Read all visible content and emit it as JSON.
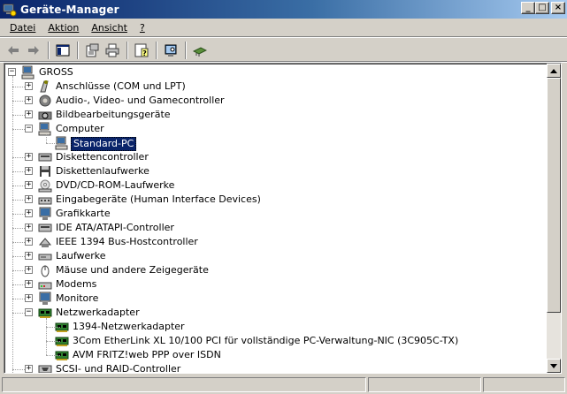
{
  "window": {
    "title": "Geräte-Manager",
    "icon": "device-manager-icon",
    "buttons": {
      "minimize": "_",
      "maximize": "□",
      "close": "×"
    }
  },
  "menu": [
    {
      "label": "Datei"
    },
    {
      "label": "Aktion"
    },
    {
      "label": "Ansicht"
    },
    {
      "label": "?"
    }
  ],
  "toolbar": [
    {
      "icon": "back-arrow-icon"
    },
    {
      "icon": "forward-arrow-icon"
    },
    {
      "sep": true
    },
    {
      "icon": "show-hide-console-tree-icon"
    },
    {
      "sep": true
    },
    {
      "icon": "properties-icon"
    },
    {
      "icon": "print-icon"
    },
    {
      "sep": true
    },
    {
      "icon": "help-icon"
    },
    {
      "sep": true
    },
    {
      "icon": "scan-hardware-icon"
    },
    {
      "sep": true
    },
    {
      "icon": "driver-update-icon"
    }
  ],
  "tree": {
    "root": {
      "label": "GROSS",
      "icon": "computer-icon",
      "expanded": true
    },
    "items": [
      {
        "label": "Anschlüsse (COM und LPT)",
        "icon": "port-icon",
        "expanded": false
      },
      {
        "label": "Audio-, Video- und Gamecontroller",
        "icon": "sound-icon",
        "expanded": false
      },
      {
        "label": "Bildbearbeitungsgeräte",
        "icon": "camera-icon",
        "expanded": false
      },
      {
        "label": "Computer",
        "icon": "computer-icon",
        "expanded": true,
        "children": [
          {
            "label": "Standard-PC",
            "icon": "computer-icon",
            "selected": true
          }
        ]
      },
      {
        "label": "Diskettencontroller",
        "icon": "controller-icon",
        "expanded": false
      },
      {
        "label": "Diskettenlaufwerke",
        "icon": "floppy-icon",
        "expanded": false
      },
      {
        "label": "DVD/CD-ROM-Laufwerke",
        "icon": "cdrom-icon",
        "expanded": false
      },
      {
        "label": "Eingabegeräte (Human Interface Devices)",
        "icon": "hid-icon",
        "expanded": false
      },
      {
        "label": "Grafikkarte",
        "icon": "monitor-icon",
        "expanded": false
      },
      {
        "label": "IDE ATA/ATAPI-Controller",
        "icon": "controller-icon",
        "expanded": false
      },
      {
        "label": "IEEE 1394 Bus-Hostcontroller",
        "icon": "firewire-icon",
        "expanded": false
      },
      {
        "label": "Laufwerke",
        "icon": "harddisk-icon",
        "expanded": false
      },
      {
        "label": "Mäuse und andere Zeigegeräte",
        "icon": "mouse-icon",
        "expanded": false
      },
      {
        "label": "Modems",
        "icon": "modem-icon",
        "expanded": false
      },
      {
        "label": "Monitore",
        "icon": "monitor-icon",
        "expanded": false
      },
      {
        "label": "Netzwerkadapter",
        "icon": "network-card-icon",
        "expanded": true,
        "children": [
          {
            "label": "1394-Netzwerkadapter",
            "icon": "network-card-icon"
          },
          {
            "label": "3Com EtherLink XL 10/100 PCI für vollständige PC-Verwaltung-NIC (3C905C-TX)",
            "icon": "network-card-icon"
          },
          {
            "label": "AVM FRITZ!web PPP over ISDN",
            "icon": "network-card-icon"
          }
        ]
      },
      {
        "label": "SCSI- und RAID-Controller",
        "icon": "scsi-icon",
        "expanded": false
      }
    ]
  },
  "statusbar": {
    "panels": [
      "",
      "",
      ""
    ]
  },
  "colors": {
    "titlebar_start": "#0a246a",
    "titlebar_end": "#a6caf0",
    "selection": "#0a246a",
    "face": "#d4d0c8"
  }
}
